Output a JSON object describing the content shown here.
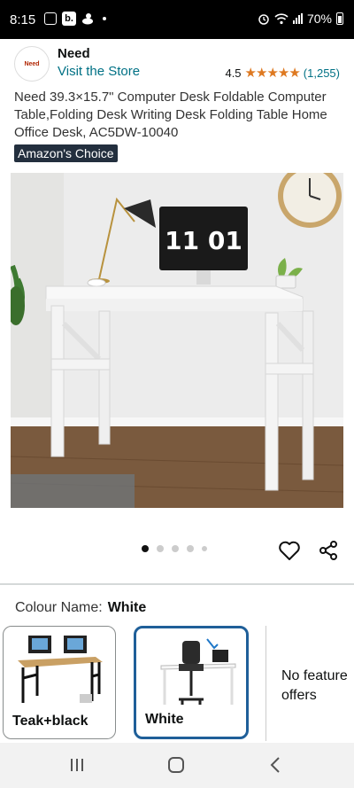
{
  "status_bar": {
    "time": "8:15",
    "battery": "70%",
    "b_icon": "b."
  },
  "brand": {
    "logo_text": "Need",
    "name": "Need",
    "visit_store": "Visit the Store",
    "rating": "4.5",
    "stars": "★★★★★",
    "review_count": "(1,255)"
  },
  "product": {
    "title": "Need 39.3×15.7\" Computer Desk Foldable Computer Table,Folding Desk Writing Desk Folding Table Home Office Desk, AC5DW-10040",
    "badge": "Amazon's Choice",
    "monitor_time": "11 01"
  },
  "carousel": {
    "total": 5,
    "active_index": 0
  },
  "colour": {
    "label": "Colour Name:",
    "value": "White",
    "options": [
      {
        "label": "Teak+black",
        "selected": false
      },
      {
        "label": "White",
        "selected": true
      }
    ]
  },
  "no_feature": {
    "line1": "No feature",
    "line2": "offers"
  },
  "colors": {
    "link": "#007185",
    "star": "#de7921",
    "badge_bg": "#232f3e",
    "selected_border": "#1f5f99"
  },
  "icons": [
    "heart-icon",
    "share-icon",
    "recents-icon",
    "home-icon",
    "back-icon"
  ]
}
